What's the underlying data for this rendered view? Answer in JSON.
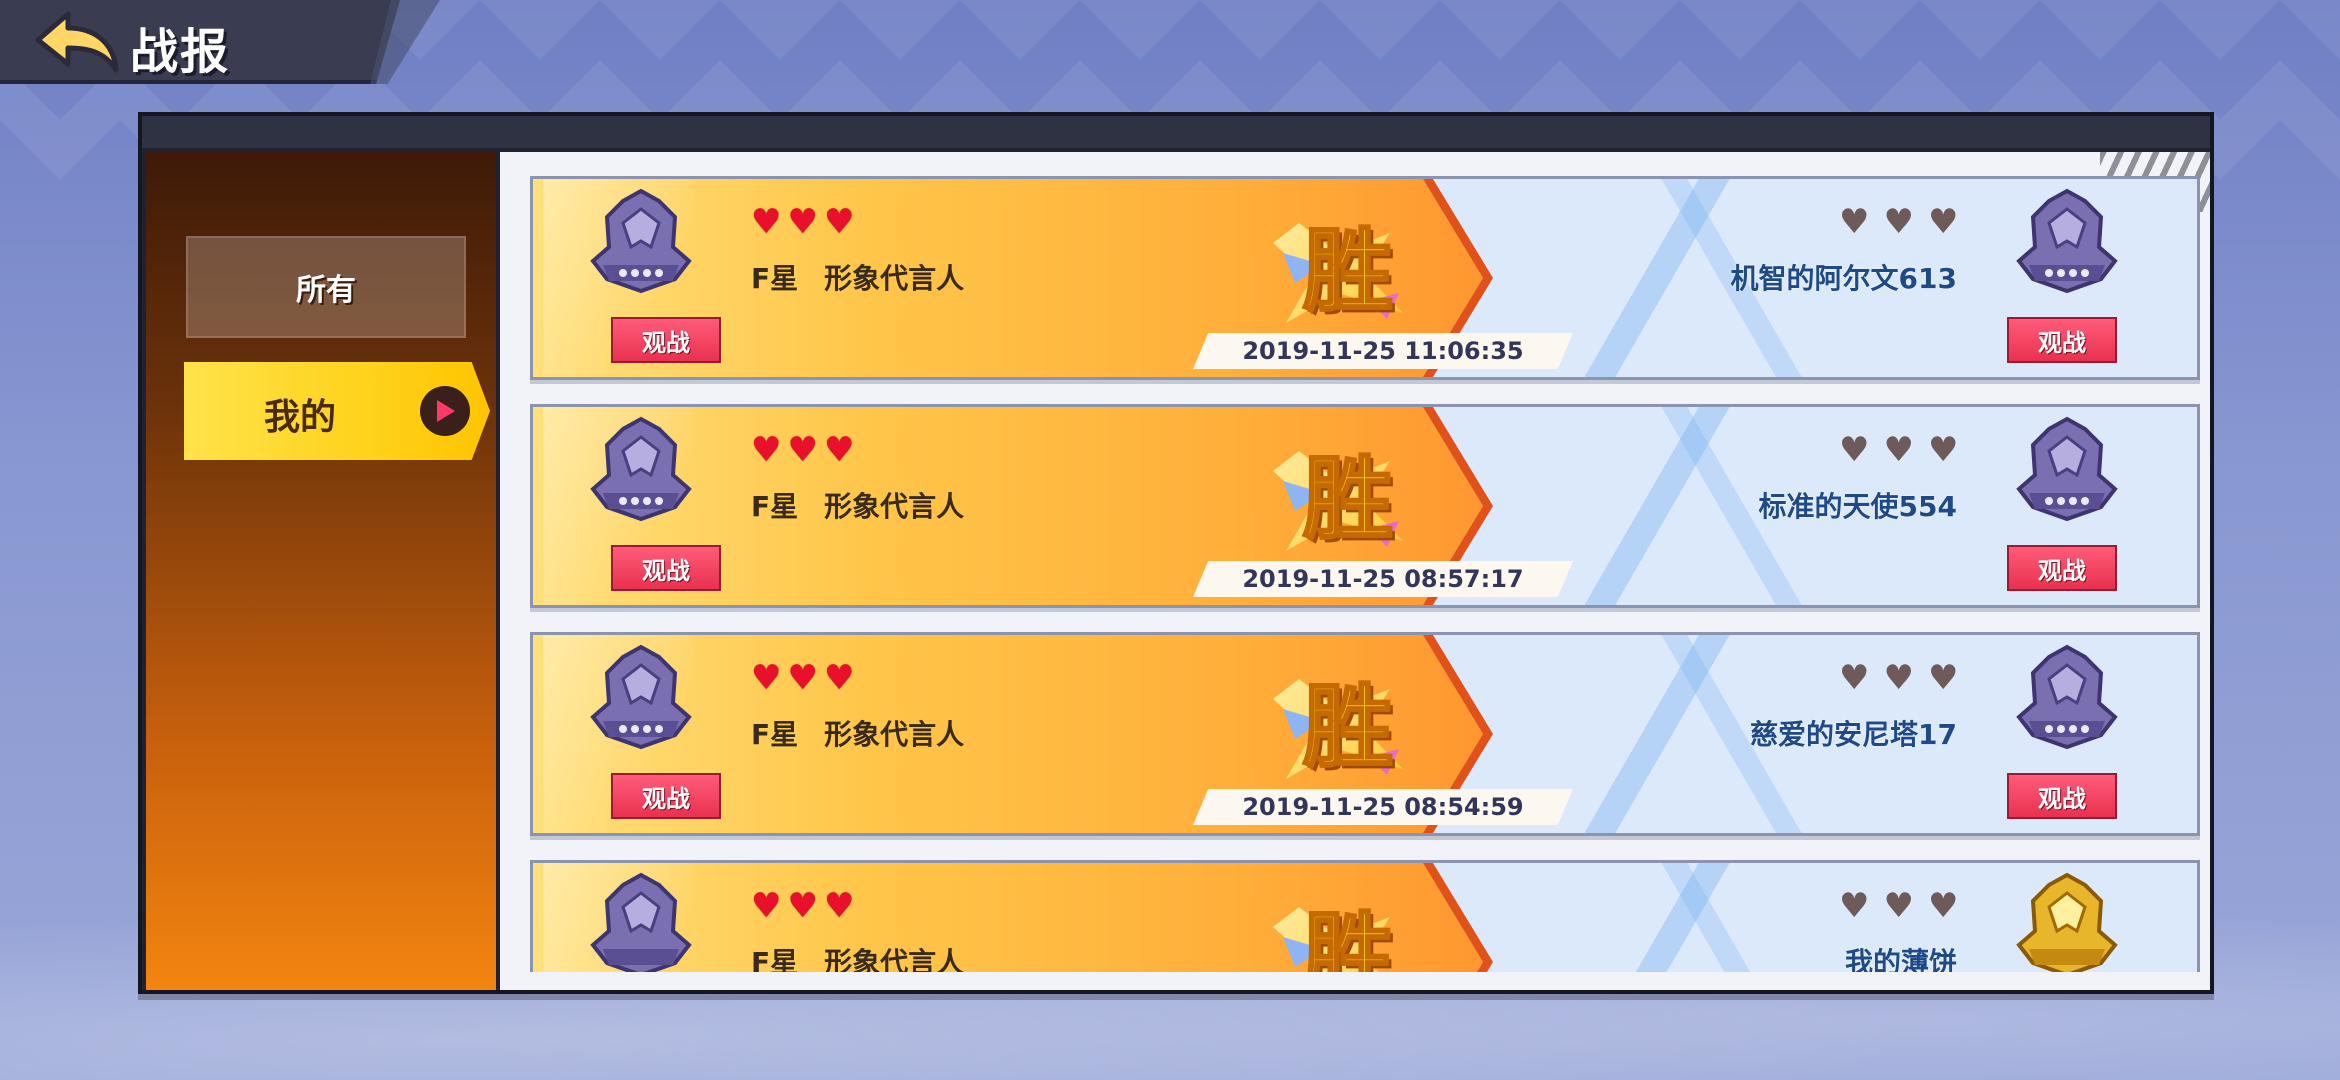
{
  "header": {
    "title": "战报",
    "back_icon": "back-arrow-icon"
  },
  "sidebar": {
    "tabs": [
      {
        "label": "所有",
        "selected": false
      },
      {
        "label": "我的",
        "selected": true
      }
    ]
  },
  "colors": {
    "win_side": "#ffb03f",
    "lose_side": "#dbe9fb",
    "heart_active": "#e8102a",
    "heart_inactive": "#6e5a58",
    "watch_button": "#e8324f"
  },
  "records": [
    {
      "left_player": {
        "rank": "F星",
        "title": "形象代言人",
        "watch_label": "观战",
        "hearts": 3,
        "emblem": "purple-shield-emblem-icon"
      },
      "result": "胜",
      "datetime": "2019-11-25 11:06:35",
      "right_player": {
        "name": "机智的阿尔文613",
        "watch_label": "观战",
        "hearts": 0,
        "emblem": "purple-shield-emblem-icon"
      }
    },
    {
      "left_player": {
        "rank": "F星",
        "title": "形象代言人",
        "watch_label": "观战",
        "hearts": 3,
        "emblem": "purple-shield-emblem-icon"
      },
      "result": "胜",
      "datetime": "2019-11-25 08:57:17",
      "right_player": {
        "name": "标准的天使554",
        "watch_label": "观战",
        "hearts": 0,
        "emblem": "purple-shield-emblem-icon"
      }
    },
    {
      "left_player": {
        "rank": "F星",
        "title": "形象代言人",
        "watch_label": "观战",
        "hearts": 3,
        "emblem": "purple-shield-emblem-icon"
      },
      "result": "胜",
      "datetime": "2019-11-25 08:54:59",
      "right_player": {
        "name": "慈爱的安尼塔17",
        "watch_label": "观战",
        "hearts": 0,
        "emblem": "purple-shield-emblem-icon"
      }
    },
    {
      "left_player": {
        "rank": "F星",
        "title": "形象代言人",
        "hearts": 3,
        "emblem": "purple-shield-emblem-icon"
      },
      "result": "胜",
      "right_player": {
        "name": "我的薄饼",
        "hearts": 0,
        "emblem": "gold-shield-emblem-icon"
      }
    }
  ]
}
